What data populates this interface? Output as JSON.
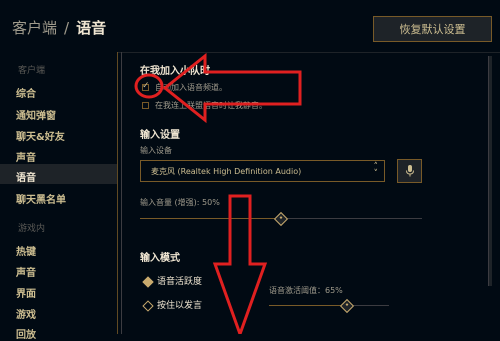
{
  "header": {
    "breadcrumb_root": "客户端",
    "breadcrumb_sep": "/",
    "page_title": "语音",
    "reset_button": "恢复默认设置"
  },
  "sidebar": {
    "client_category": "客户端",
    "client_items": [
      "综合",
      "通知弹窗",
      "聊天&好友",
      "声音",
      "语音",
      "聊天黑名单"
    ],
    "active_item": "语音",
    "ingame_category": "游戏内",
    "ingame_items": [
      "热键",
      "声音",
      "界面",
      "游戏",
      "回放"
    ]
  },
  "join_party": {
    "title": "在我加入小队时",
    "auto_join": {
      "label": "自动加入语音频道。",
      "checked": true
    },
    "mute_on_join": {
      "label": "在我连上联盟语音时让我静音。",
      "checked": false
    }
  },
  "input_settings": {
    "title": "输入设置",
    "device_label": "输入设备",
    "device_value": "麦克风 (Realtek High Definition Audio)",
    "volume_label": "输入音量 (增强): 50%",
    "volume_value": 0.5
  },
  "input_mode": {
    "title": "输入模式",
    "options": [
      {
        "label": "语音活跃度",
        "selected": true
      },
      {
        "label": "按住以发言",
        "selected": false
      }
    ],
    "threshold_label": "语音激活阈值：65%",
    "threshold_value": 0.65
  },
  "icons": [
    "microphone-icon",
    "chevron-up-icon",
    "chevron-down-icon",
    "check-icon"
  ],
  "colors": {
    "gold": "#c8aa6e",
    "gold_dark": "#785a28",
    "annotation_red": "#e02020",
    "background": "#010a13"
  }
}
